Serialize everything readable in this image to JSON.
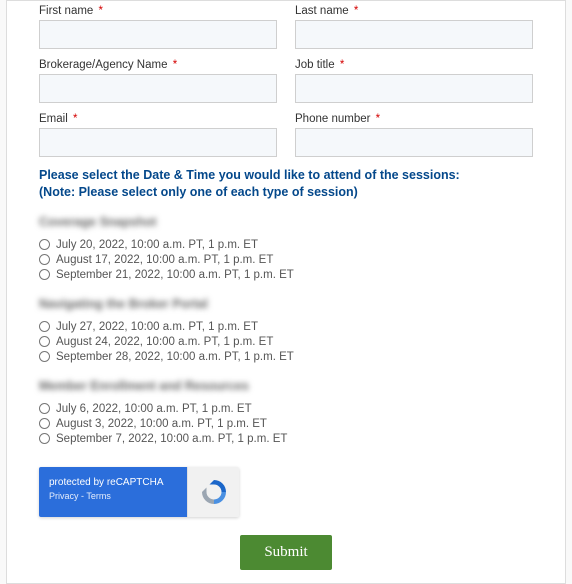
{
  "fields": {
    "first_name": {
      "label": "First name",
      "required": "*"
    },
    "last_name": {
      "label": "Last name",
      "required": "*"
    },
    "brokerage": {
      "label": "Brokerage/Agency Name",
      "required": "*"
    },
    "job_title": {
      "label": "Job title",
      "required": "*"
    },
    "email": {
      "label": "Email",
      "required": "*"
    },
    "phone": {
      "label": "Phone number",
      "required": "*"
    }
  },
  "instructions": {
    "line1": "Please select the Date & Time you would like to attend of the sessions:",
    "line2": "(Note: Please select only one of each type of session)"
  },
  "sessions": {
    "group1": {
      "title": "Coverage Snapshot",
      "opts": [
        "July 20, 2022, 10:00 a.m. PT, 1 p.m. ET",
        "August 17, 2022, 10:00 a.m. PT, 1 p.m. ET",
        "September 21, 2022, 10:00 a.m. PT, 1 p.m. ET"
      ]
    },
    "group2": {
      "title": "Navigating the Broker Portal",
      "opts": [
        "July 27, 2022, 10:00 a.m. PT, 1 p.m. ET",
        "August 24, 2022, 10:00 a.m. PT, 1 p.m. ET",
        "September 28, 2022, 10:00 a.m. PT, 1 p.m. ET"
      ]
    },
    "group3": {
      "title": "Member Enrollment and Resources",
      "opts": [
        "July 6, 2022, 10:00 a.m. PT, 1 p.m. ET",
        "August 3, 2022, 10:00 a.m. PT, 1 p.m. ET",
        "September 7, 2022, 10:00 a.m. PT, 1 p.m. ET"
      ]
    }
  },
  "recaptcha": {
    "protected": "protected by reCAPTCHA",
    "privacy": "Privacy",
    "dash": " - ",
    "terms": "Terms"
  },
  "submit": "Submit"
}
